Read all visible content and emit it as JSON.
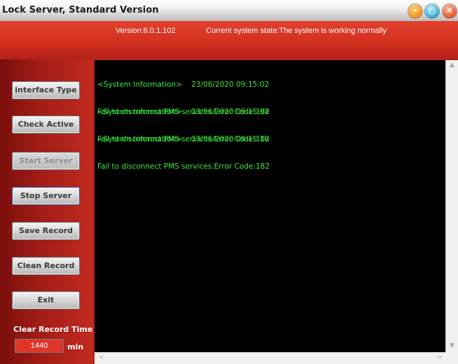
{
  "window": {
    "title": "Lock Server, Standard Version",
    "controls": {
      "minimize_icon": "–",
      "restore_icon": "○",
      "close_icon": "✕"
    }
  },
  "header": {
    "version": "Version:6.0.1.102",
    "system_state": "Current system state:The system is working normally"
  },
  "sidebar": {
    "buttons": [
      {
        "label": "interface Type",
        "enabled": true
      },
      {
        "label": "Check Active",
        "enabled": true
      },
      {
        "label": "Start Server",
        "enabled": false
      },
      {
        "label": "Stop Server",
        "enabled": true
      },
      {
        "label": "Save Record",
        "enabled": true
      },
      {
        "label": "Clean Record",
        "enabled": true
      },
      {
        "label": "Exit",
        "enabled": true
      }
    ],
    "clear_record_label": "Clear Record Time",
    "clear_record_value": "1440",
    "clear_record_unit": "min"
  },
  "log": {
    "entries": [
      {
        "header": "<System Information>    23/06/2020 09:15:02",
        "message": "Fail to disconnect PMS services.Error Code:182"
      },
      {
        "header": "<System Information>    23/06/2020 09:15:08",
        "message": "Fail to disconnect PMS services.Error Code:182"
      },
      {
        "header": "<System Information>    23/06/2020 09:15:16",
        "message": "Fail to disconnect PMS services.Error Code:182"
      }
    ]
  },
  "scrollbars": {
    "up_arrow": "▲",
    "down_arrow": "▼",
    "left_arrow": "<",
    "right_arrow": ">"
  },
  "colors": {
    "accent_red": "#d3301f",
    "log_text": "#39e739",
    "log_background": "#000000"
  }
}
